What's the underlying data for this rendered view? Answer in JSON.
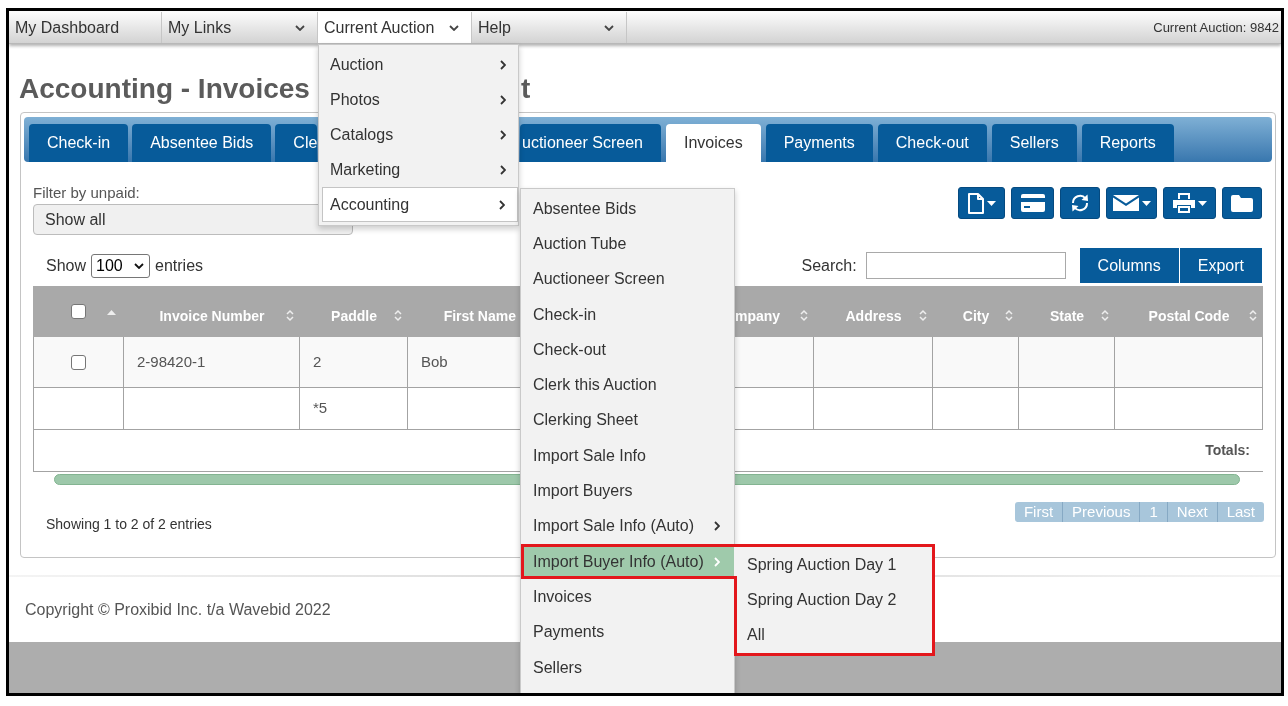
{
  "nav": {
    "items": [
      {
        "label": "My Dashboard",
        "has_menu": false,
        "selected": false
      },
      {
        "label": "My Links",
        "has_menu": true,
        "selected": false
      },
      {
        "label": "Current Auction",
        "has_menu": true,
        "selected": true
      },
      {
        "label": "Help",
        "has_menu": true,
        "selected": false
      }
    ],
    "current_auction": "Current Auction: 9842"
  },
  "page": {
    "title": "Accounting - Invoices",
    "title_tail": "t"
  },
  "tabs": [
    {
      "label": "Check-in",
      "selected": false
    },
    {
      "label": "Absentee Bids",
      "selected": false
    },
    {
      "label": "Cle",
      "selected": false,
      "clipped_end": true
    },
    {
      "label": "uctioneer Screen",
      "selected": false,
      "clipped_start": true
    },
    {
      "label": "Invoices",
      "selected": true
    },
    {
      "label": "Payments",
      "selected": false
    },
    {
      "label": "Check-out",
      "selected": false
    },
    {
      "label": "Sellers",
      "selected": false
    },
    {
      "label": "Reports",
      "selected": false
    }
  ],
  "filter": {
    "label": "Filter by unpaid:",
    "value": "Show all"
  },
  "toolbar": [
    {
      "kind": "document",
      "menu": true
    },
    {
      "kind": "card",
      "menu": false
    },
    {
      "kind": "refresh",
      "menu": false
    },
    {
      "kind": "mail",
      "menu": true
    },
    {
      "kind": "print",
      "menu": true
    },
    {
      "kind": "folder",
      "menu": false
    }
  ],
  "length_menu": {
    "before": "Show",
    "value": "100",
    "after": "entries"
  },
  "search": {
    "label": "Search:"
  },
  "table_buttons": [
    {
      "label": "Columns"
    },
    {
      "label": "Export"
    }
  ],
  "table": {
    "columns": [
      {
        "kind": "checkbox",
        "checked": false,
        "sorted": true
      },
      {
        "kind": "text",
        "label": "Invoice Number",
        "sorted": false
      },
      {
        "kind": "text",
        "label": "Paddle",
        "sorted": false
      },
      {
        "kind": "text",
        "label": "First Name",
        "clipped_end": true
      },
      {
        "kind": "text",
        "label": "mpany",
        "sorted": false,
        "clipped_start": true
      },
      {
        "kind": "text",
        "label": "Address",
        "sorted": false
      },
      {
        "kind": "text",
        "label": "City",
        "sorted": false
      },
      {
        "kind": "text",
        "label": "State",
        "sorted": false
      },
      {
        "kind": "text",
        "label": "Postal Code",
        "sorted": false
      }
    ],
    "rows": [
      {
        "checked": false,
        "invoice_number": "2-98420-1",
        "paddle": "2",
        "first_name": "Bob"
      },
      {
        "paddle": "*5"
      }
    ],
    "totals_label": "Totals:"
  },
  "info": "Showing 1 to 2 of 2 entries",
  "pagination": [
    {
      "label": "First",
      "disabled": true
    },
    {
      "label": "Previous",
      "disabled": true
    },
    {
      "label": "1",
      "disabled": true
    },
    {
      "label": "Next",
      "disabled": true
    },
    {
      "label": "Last",
      "disabled": true
    }
  ],
  "footer": {
    "copyright": "Copyright © Proxibid Inc. t/a Wavebid 2022"
  },
  "dropdown": {
    "items": [
      {
        "label": "Auction",
        "has_submenu": true,
        "selected": false
      },
      {
        "label": "Photos",
        "has_submenu": true,
        "selected": false
      },
      {
        "label": "Catalogs",
        "has_submenu": true,
        "selected": false
      },
      {
        "label": "Marketing",
        "has_submenu": true,
        "selected": false
      },
      {
        "label": "Accounting",
        "has_submenu": true,
        "selected": true,
        "children": [
          {
            "label": "Absentee Bids",
            "has_submenu": false,
            "selected": false
          },
          {
            "label": "Auction Tube",
            "has_submenu": false,
            "selected": false
          },
          {
            "label": "Auctioneer Screen",
            "has_submenu": false,
            "selected": false
          },
          {
            "label": "Check-in",
            "has_submenu": false,
            "selected": false
          },
          {
            "label": "Check-out",
            "has_submenu": false,
            "selected": false
          },
          {
            "label": "Clerk this Auction",
            "has_submenu": false,
            "selected": false
          },
          {
            "label": "Clerking Sheet",
            "has_submenu": false,
            "selected": false
          },
          {
            "label": "Import Sale Info",
            "has_submenu": false,
            "selected": false
          },
          {
            "label": "Import Buyers",
            "has_submenu": false,
            "selected": false
          },
          {
            "label": "Import Sale Info (Auto)",
            "has_submenu": true,
            "selected": false
          },
          {
            "label": "Import Buyer Info (Auto)",
            "has_submenu": true,
            "selected": true,
            "outlined": true,
            "children": [
              {
                "label": "Spring Auction Day 1"
              },
              {
                "label": "Spring Auction Day 2"
              },
              {
                "label": "All"
              }
            ]
          },
          {
            "label": "Invoices",
            "has_submenu": false,
            "selected": false
          },
          {
            "label": "Payments",
            "has_submenu": false,
            "selected": false
          },
          {
            "label": "Sellers",
            "has_submenu": false,
            "selected": false
          }
        ]
      }
    ]
  }
}
